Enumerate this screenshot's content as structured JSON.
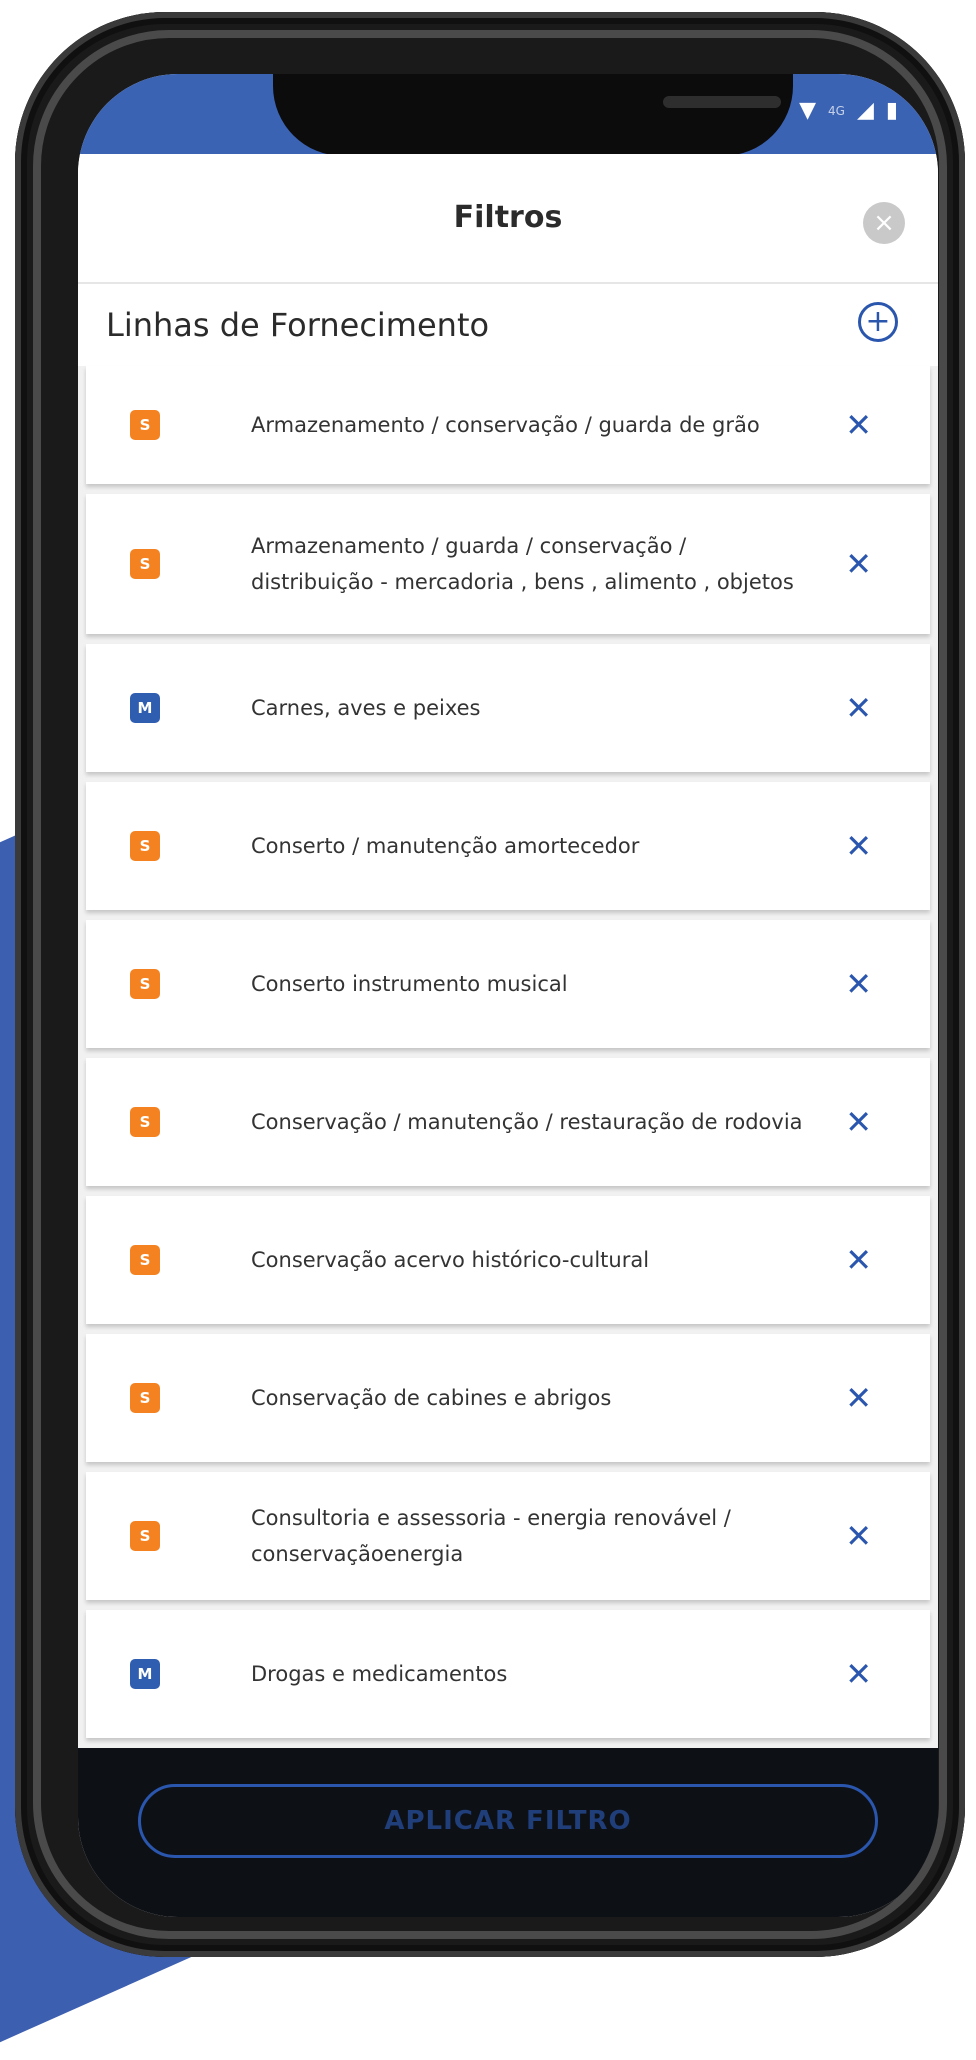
{
  "header": {
    "title": "Filtros",
    "close_icon": "close-circle-icon"
  },
  "section": {
    "title": "Linhas de Fornecimento",
    "add_icon": "add-circle-icon"
  },
  "items": [
    {
      "badge": "S",
      "type": "s",
      "label": "Armazenamento / conservação / guarda de grão"
    },
    {
      "badge": "S",
      "type": "s",
      "label": "Armazenamento / guarda / conservação / distribuição - mercadoria , bens , alimento , objetos"
    },
    {
      "badge": "M",
      "type": "m",
      "label": "Carnes, aves e peixes"
    },
    {
      "badge": "S",
      "type": "s",
      "label": "Conserto / manutenção amortecedor"
    },
    {
      "badge": "S",
      "type": "s",
      "label": "Conserto instrumento musical"
    },
    {
      "badge": "S",
      "type": "s",
      "label": "Conservação / manutenção / restauração de rodovia"
    },
    {
      "badge": "S",
      "type": "s",
      "label": "Conservação acervo histórico-cultural"
    },
    {
      "badge": "S",
      "type": "s",
      "label": "Conservação de cabines e abrigos"
    },
    {
      "badge": "S",
      "type": "s",
      "label": "Consultoria e assessoria - energia renovável / conservaçãoenergia"
    },
    {
      "badge": "M",
      "type": "m",
      "label": "Drogas e medicamentos"
    }
  ],
  "remove_label": "✕",
  "footer": {
    "apply_label": "APLICAR FILTRO"
  },
  "status": {
    "network": "4G"
  },
  "colors": {
    "brand_blue": "#2a56ae",
    "status_blue": "#3b63b3",
    "badge_s": "#f48221",
    "badge_m": "#2f5db0"
  }
}
